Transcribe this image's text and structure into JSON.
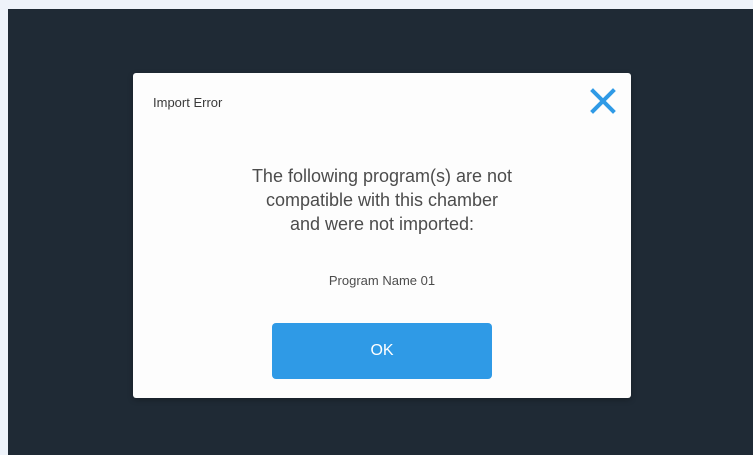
{
  "dialog": {
    "title": "Import Error",
    "close_icon": "close-icon",
    "message_lines": [
      "The following program(s) are not",
      "compatible with this chamber",
      "and were not imported:"
    ],
    "program_name": "Program Name 01",
    "ok_label": "OK"
  },
  "colors": {
    "page_background": "#eef3fa",
    "screen_background": "#1f2a35",
    "dialog_background": "#fdfdfd",
    "accent": "#2f9ae6",
    "text": "#4c4c4c"
  }
}
